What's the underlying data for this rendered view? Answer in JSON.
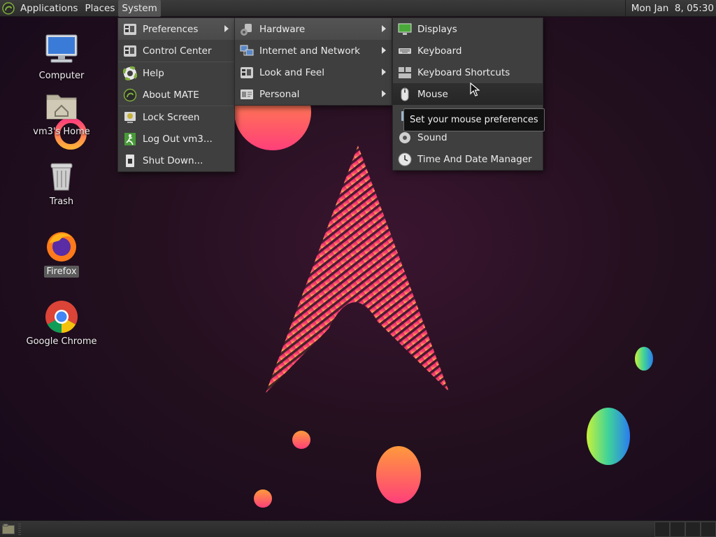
{
  "panel": {
    "menus": [
      "Applications",
      "Places",
      "System"
    ],
    "active_menu": "System",
    "clock": "Mon Jan  8, 05:30"
  },
  "desktop_icons": [
    {
      "label": "Computer",
      "icon": "computer-icon"
    },
    {
      "label": "vm3's Home",
      "icon": "home-folder-icon"
    },
    {
      "label": "Trash",
      "icon": "trash-icon"
    },
    {
      "label": "Firefox",
      "icon": "firefox-icon",
      "selected": true
    },
    {
      "label": "Google Chrome",
      "icon": "chrome-icon"
    }
  ],
  "system_menu": {
    "items": [
      {
        "label": "Preferences",
        "icon": "preferences-icon",
        "submenu": true
      },
      {
        "label": "Control Center",
        "icon": "control-center-icon"
      },
      {
        "label": "Help",
        "icon": "help-icon"
      },
      {
        "label": "About MATE",
        "icon": "about-mate-icon"
      },
      {
        "label": "Lock Screen",
        "icon": "lock-screen-icon"
      },
      {
        "label": "Log Out vm3...",
        "icon": "log-out-icon"
      },
      {
        "label": "Shut Down...",
        "icon": "shut-down-icon"
      }
    ]
  },
  "preferences_menu": {
    "items": [
      {
        "label": "Hardware",
        "icon": "hardware-icon",
        "submenu": true
      },
      {
        "label": "Internet and Network",
        "icon": "network-icon",
        "submenu": true
      },
      {
        "label": "Look and Feel",
        "icon": "look-and-feel-icon",
        "submenu": true
      },
      {
        "label": "Personal",
        "icon": "personal-icon",
        "submenu": true
      }
    ]
  },
  "hardware_menu": {
    "items": [
      {
        "label": "Displays",
        "icon": "displays-icon"
      },
      {
        "label": "Keyboard",
        "icon": "keyboard-icon"
      },
      {
        "label": "Keyboard Shortcuts",
        "icon": "keyboard-shortcuts-icon"
      },
      {
        "label": "Mouse",
        "icon": "mouse-icon",
        "hovered": true
      },
      {
        "label": "Sound",
        "icon": "sound-icon"
      },
      {
        "label": "Time And Date Manager",
        "icon": "clock-icon"
      }
    ]
  },
  "tooltip": "Set your mouse preferences",
  "colors": {
    "panel": "#2f2f2f",
    "menu_bg": "#3f3f3f",
    "menu_highlight": "#545454",
    "wallpaper_bg": "#24101f",
    "accent_pink": "#e8246e",
    "accent_orange": "#ff8a3d"
  }
}
